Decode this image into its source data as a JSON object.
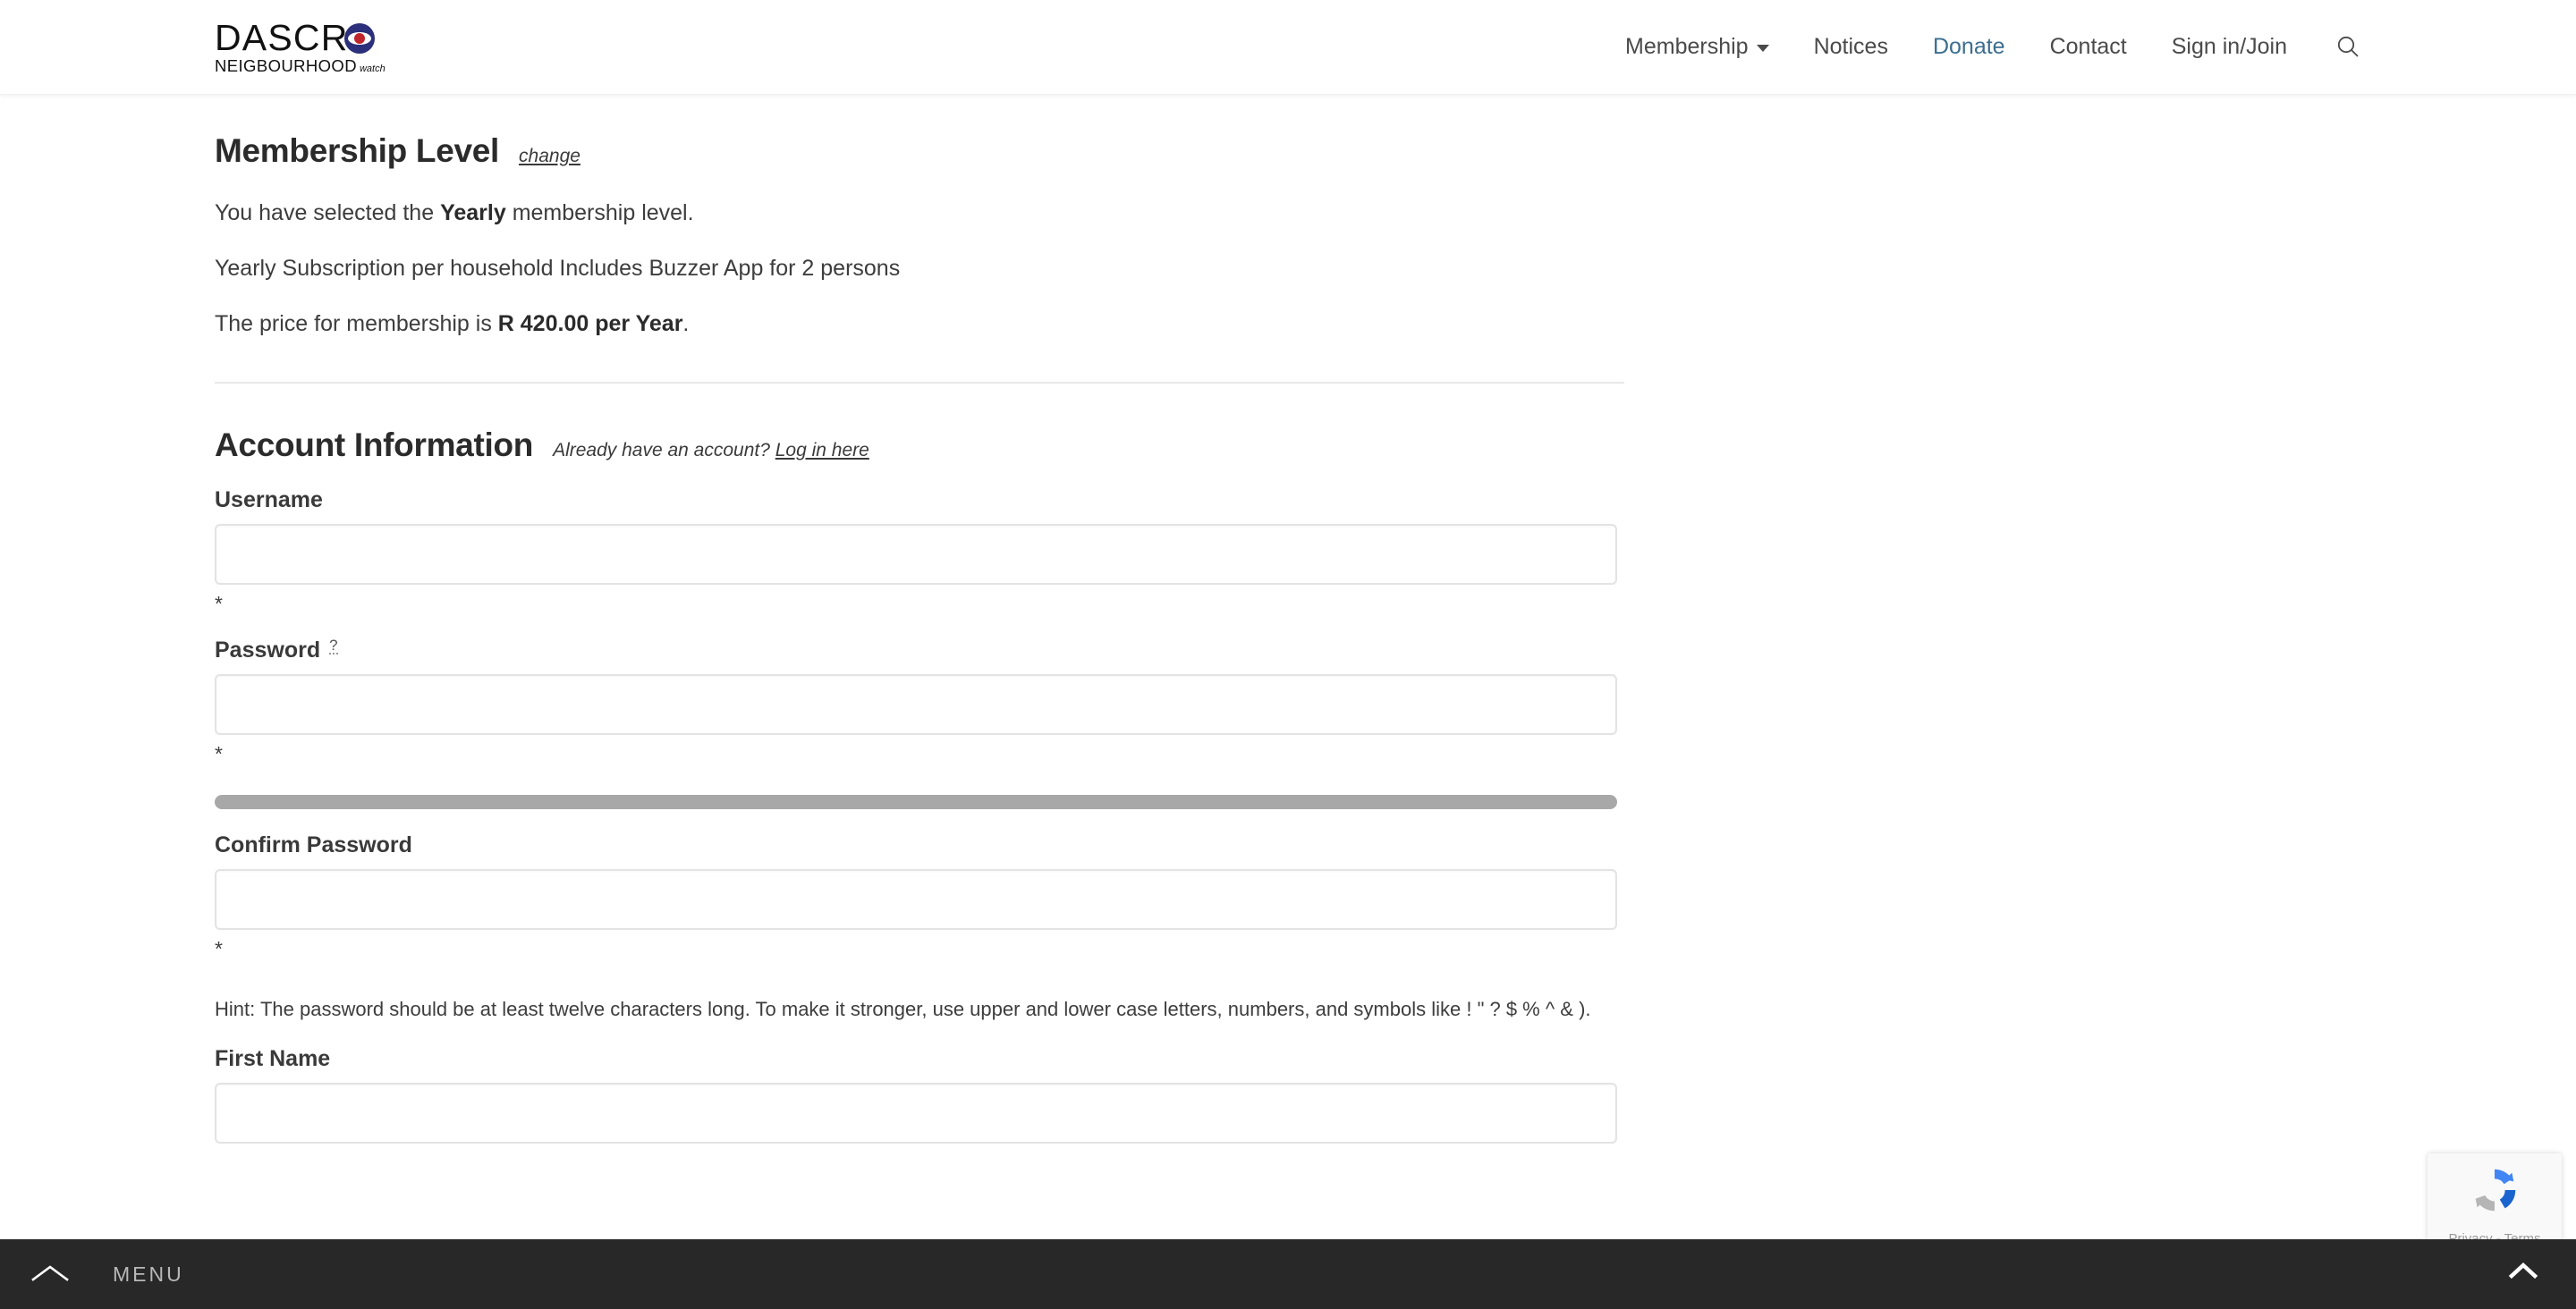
{
  "header": {
    "logo": {
      "word": "DASCR",
      "subtitle_main": "NEIGBOURHOOD",
      "subtitle_small": "watch",
      "eye_colors": {
        "ring": "#2c2f7a",
        "pupil": "#c0252b"
      }
    },
    "nav": [
      {
        "label": "Membership",
        "has_caret": true,
        "active": false
      },
      {
        "label": "Notices",
        "has_caret": false,
        "active": false
      },
      {
        "label": "Donate",
        "has_caret": false,
        "active": true
      },
      {
        "label": "Contact",
        "has_caret": false,
        "active": false
      },
      {
        "label": "Sign in/Join",
        "has_caret": false,
        "active": false
      }
    ],
    "search_icon": "search-icon",
    "accent_color": "#3b6e8f"
  },
  "membership_level": {
    "title": "Membership Level",
    "change_link": "change",
    "selected_line_pre": "You have selected the ",
    "selected_level": "Yearly",
    "selected_line_post": " membership level.",
    "description": "Yearly Subscription per household Includes Buzzer App for 2 persons",
    "price_line_pre": "The price for membership is ",
    "price": "R 420.00 per Year",
    "price_line_post": "."
  },
  "account_information": {
    "title": "Account Information",
    "already_account_text": "Already have an account? ",
    "login_link": "Log in here",
    "fields": [
      {
        "label": "Username",
        "value": "",
        "required_marker": "*",
        "help": null
      },
      {
        "label": "Password",
        "value": "",
        "required_marker": "*",
        "help": "?"
      },
      {
        "label": "Confirm Password",
        "value": "",
        "required_marker": "*",
        "help": null
      },
      {
        "label": "First Name",
        "value": "",
        "required_marker": "",
        "help": null
      }
    ],
    "password_strength_color": "#a8a8a8",
    "hint": "Hint: The password should be at least twelve characters long. To make it stronger, use upper and lower case letters, numbers, and symbols like ! \" ? $ % ^ & )."
  },
  "bottom_bar": {
    "toggle_icon": "chevron-up-icon",
    "menu_label": "MENU",
    "background": "#282828"
  },
  "recaptcha": {
    "terms": "Privacy - Terms",
    "logo_icon": "recaptcha-icon"
  },
  "scroll_top": {
    "icon": "chevron-up-icon"
  }
}
